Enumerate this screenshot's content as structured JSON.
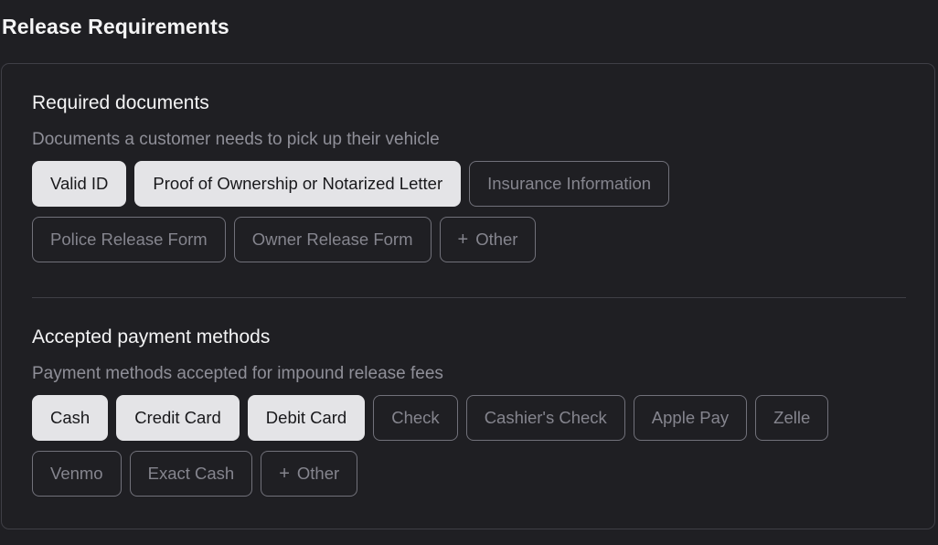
{
  "page": {
    "title": "Release Requirements"
  },
  "documents": {
    "title": "Required documents",
    "description": "Documents a customer needs to pick up their vehicle",
    "options": [
      {
        "label": "Valid ID",
        "selected": true
      },
      {
        "label": "Proof of Ownership or Notarized Letter",
        "selected": true
      },
      {
        "label": "Insurance Information",
        "selected": false
      },
      {
        "label": "Police Release Form",
        "selected": false
      },
      {
        "label": "Owner Release Form",
        "selected": false
      }
    ],
    "other_label": "Other"
  },
  "payment": {
    "title": "Accepted payment methods",
    "description": "Payment methods accepted for impound release fees",
    "options": [
      {
        "label": "Cash",
        "selected": true
      },
      {
        "label": "Credit Card",
        "selected": true
      },
      {
        "label": "Debit Card",
        "selected": true
      },
      {
        "label": "Check",
        "selected": false
      },
      {
        "label": "Cashier's Check",
        "selected": false
      },
      {
        "label": "Apple Pay",
        "selected": false
      },
      {
        "label": "Zelle",
        "selected": false
      },
      {
        "label": "Venmo",
        "selected": false
      },
      {
        "label": "Exact Cash",
        "selected": false
      }
    ],
    "other_label": "Other"
  },
  "icons": {
    "add": "plus-icon"
  },
  "colors": {
    "background": "#1f1f23",
    "selected_chip": "#e4e4e7",
    "chip_border": "#71717a",
    "muted_text": "#8f8f98"
  }
}
